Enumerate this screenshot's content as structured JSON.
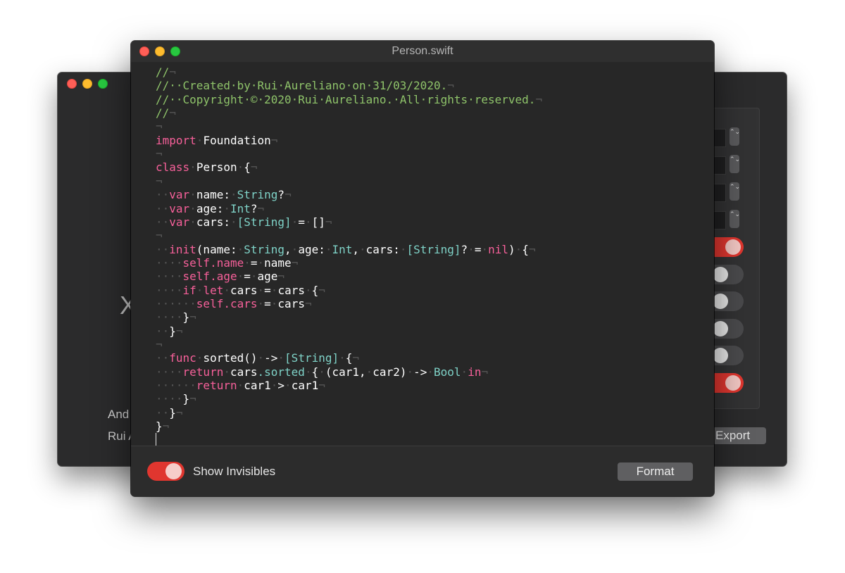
{
  "back_window": {
    "big_letter": "X",
    "author_line_1": "And",
    "author_line_2": "Rui A",
    "export_label": "Export",
    "toggles": [
      true,
      false,
      false,
      false,
      false,
      true
    ],
    "stepper_icon": "⌃⌄"
  },
  "front_window": {
    "title": "Person.swift",
    "invisible_marker": "¬",
    "code_lines": [
      [
        [
          "//",
          "comment"
        ],
        [
          "¬",
          "inv"
        ]
      ],
      [
        [
          "//",
          "comment"
        ],
        [
          "··Created·by·Rui·Aureliano·on·31/03/2020.",
          "comment"
        ],
        [
          "¬",
          "inv"
        ]
      ],
      [
        [
          "//",
          "comment"
        ],
        [
          "··Copyright·©·2020·Rui·Aureliano.·All·rights·reserved.",
          "comment"
        ],
        [
          "¬",
          "inv"
        ]
      ],
      [
        [
          "//",
          "comment"
        ],
        [
          "¬",
          "inv"
        ]
      ],
      [
        [
          "¬",
          "inv"
        ]
      ],
      [
        [
          "import",
          "kw"
        ],
        [
          "·",
          "inv"
        ],
        [
          "Foundation",
          "plain"
        ],
        [
          "¬",
          "inv"
        ]
      ],
      [
        [
          "¬",
          "inv"
        ]
      ],
      [
        [
          "class",
          "kw"
        ],
        [
          "·",
          "inv"
        ],
        [
          "Person",
          "plain"
        ],
        [
          "·",
          "inv"
        ],
        [
          "{",
          "plain"
        ],
        [
          "¬",
          "inv"
        ]
      ],
      [
        [
          "¬",
          "inv"
        ]
      ],
      [
        [
          "··",
          "inv"
        ],
        [
          "var",
          "kw"
        ],
        [
          "·",
          "inv"
        ],
        [
          "name:",
          "plain"
        ],
        [
          "·",
          "inv"
        ],
        [
          "String",
          "type"
        ],
        [
          "?",
          "plain"
        ],
        [
          "¬",
          "inv"
        ]
      ],
      [
        [
          "··",
          "inv"
        ],
        [
          "var",
          "kw"
        ],
        [
          "·",
          "inv"
        ],
        [
          "age:",
          "plain"
        ],
        [
          "·",
          "inv"
        ],
        [
          "Int",
          "type"
        ],
        [
          "?",
          "plain"
        ],
        [
          "¬",
          "inv"
        ]
      ],
      [
        [
          "··",
          "inv"
        ],
        [
          "var",
          "kw"
        ],
        [
          "·",
          "inv"
        ],
        [
          "cars:",
          "plain"
        ],
        [
          "·",
          "inv"
        ],
        [
          "[String]",
          "type"
        ],
        [
          "·",
          "inv"
        ],
        [
          "=",
          "plain"
        ],
        [
          "·",
          "inv"
        ],
        [
          "[]",
          "plain"
        ],
        [
          "¬",
          "inv"
        ]
      ],
      [
        [
          "¬",
          "inv"
        ]
      ],
      [
        [
          "··",
          "inv"
        ],
        [
          "init",
          "kw"
        ],
        [
          "(name:",
          "plain"
        ],
        [
          "·",
          "inv"
        ],
        [
          "String",
          "type"
        ],
        [
          ",",
          "plain"
        ],
        [
          "·",
          "inv"
        ],
        [
          "age:",
          "plain"
        ],
        [
          "·",
          "inv"
        ],
        [
          "Int",
          "type"
        ],
        [
          ",",
          "plain"
        ],
        [
          "·",
          "inv"
        ],
        [
          "cars:",
          "plain"
        ],
        [
          "·",
          "inv"
        ],
        [
          "[String]",
          "type"
        ],
        [
          "?",
          "plain"
        ],
        [
          "·",
          "inv"
        ],
        [
          "=",
          "plain"
        ],
        [
          "·",
          "inv"
        ],
        [
          "nil",
          "kw"
        ],
        [
          ")",
          "plain"
        ],
        [
          "·",
          "inv"
        ],
        [
          "{",
          "plain"
        ],
        [
          "¬",
          "inv"
        ]
      ],
      [
        [
          "····",
          "inv"
        ],
        [
          "self",
          "kw"
        ],
        [
          ".name",
          "kw"
        ],
        [
          "·",
          "inv"
        ],
        [
          "=",
          "plain"
        ],
        [
          "·",
          "inv"
        ],
        [
          "name",
          "plain"
        ],
        [
          "¬",
          "inv"
        ]
      ],
      [
        [
          "····",
          "inv"
        ],
        [
          "self",
          "kw"
        ],
        [
          ".age",
          "kw"
        ],
        [
          "·",
          "inv"
        ],
        [
          "=",
          "plain"
        ],
        [
          "·",
          "inv"
        ],
        [
          "age",
          "plain"
        ],
        [
          "¬",
          "inv"
        ]
      ],
      [
        [
          "····",
          "inv"
        ],
        [
          "if",
          "kw"
        ],
        [
          "·",
          "inv"
        ],
        [
          "let",
          "kw"
        ],
        [
          "·",
          "inv"
        ],
        [
          "cars",
          "plain"
        ],
        [
          "·",
          "inv"
        ],
        [
          "=",
          "plain"
        ],
        [
          "·",
          "inv"
        ],
        [
          "cars",
          "plain"
        ],
        [
          "·",
          "inv"
        ],
        [
          "{",
          "plain"
        ],
        [
          "¬",
          "inv"
        ]
      ],
      [
        [
          "······",
          "inv"
        ],
        [
          "self",
          "kw"
        ],
        [
          ".cars",
          "kw"
        ],
        [
          "·",
          "inv"
        ],
        [
          "=",
          "plain"
        ],
        [
          "·",
          "inv"
        ],
        [
          "cars",
          "plain"
        ],
        [
          "¬",
          "inv"
        ]
      ],
      [
        [
          "····",
          "inv"
        ],
        [
          "}",
          "plain"
        ],
        [
          "¬",
          "inv"
        ]
      ],
      [
        [
          "··",
          "inv"
        ],
        [
          "}",
          "plain"
        ],
        [
          "¬",
          "inv"
        ]
      ],
      [
        [
          "¬",
          "inv"
        ]
      ],
      [
        [
          "··",
          "inv"
        ],
        [
          "func",
          "kw"
        ],
        [
          "·",
          "inv"
        ],
        [
          "sorted()",
          "plain"
        ],
        [
          "·",
          "inv"
        ],
        [
          "->",
          "plain"
        ],
        [
          "·",
          "inv"
        ],
        [
          "[String]",
          "type"
        ],
        [
          "·",
          "inv"
        ],
        [
          "{",
          "plain"
        ],
        [
          "¬",
          "inv"
        ]
      ],
      [
        [
          "····",
          "inv"
        ],
        [
          "return",
          "kw"
        ],
        [
          "·",
          "inv"
        ],
        [
          "cars",
          "plain"
        ],
        [
          ".sorted",
          "type"
        ],
        [
          "·",
          "inv"
        ],
        [
          "{",
          "plain"
        ],
        [
          "·",
          "inv"
        ],
        [
          "(car1,",
          "plain"
        ],
        [
          "·",
          "inv"
        ],
        [
          "car2)",
          "plain"
        ],
        [
          "·",
          "inv"
        ],
        [
          "->",
          "plain"
        ],
        [
          "·",
          "inv"
        ],
        [
          "Bool",
          "type"
        ],
        [
          "·",
          "inv"
        ],
        [
          "in",
          "kw"
        ],
        [
          "¬",
          "inv"
        ]
      ],
      [
        [
          "······",
          "inv"
        ],
        [
          "return",
          "kw"
        ],
        [
          "·",
          "inv"
        ],
        [
          "car1",
          "plain"
        ],
        [
          "·",
          "inv"
        ],
        [
          ">",
          "plain"
        ],
        [
          "·",
          "inv"
        ],
        [
          "car1",
          "plain"
        ],
        [
          "¬",
          "inv"
        ]
      ],
      [
        [
          "····",
          "inv"
        ],
        [
          "}",
          "plain"
        ],
        [
          "¬",
          "inv"
        ]
      ],
      [
        [
          "··",
          "inv"
        ],
        [
          "}",
          "plain"
        ],
        [
          "¬",
          "inv"
        ]
      ],
      [
        [
          "}",
          "plain"
        ],
        [
          "¬",
          "inv"
        ]
      ]
    ],
    "footer": {
      "toggle_label": "Show Invisibles",
      "toggle_on": true,
      "format_label": "Format"
    }
  },
  "colors": {
    "comment": "#8fc46a",
    "keyword": "#f7609a",
    "type": "#7fd3c8",
    "toggle_on": "#e0362f"
  }
}
